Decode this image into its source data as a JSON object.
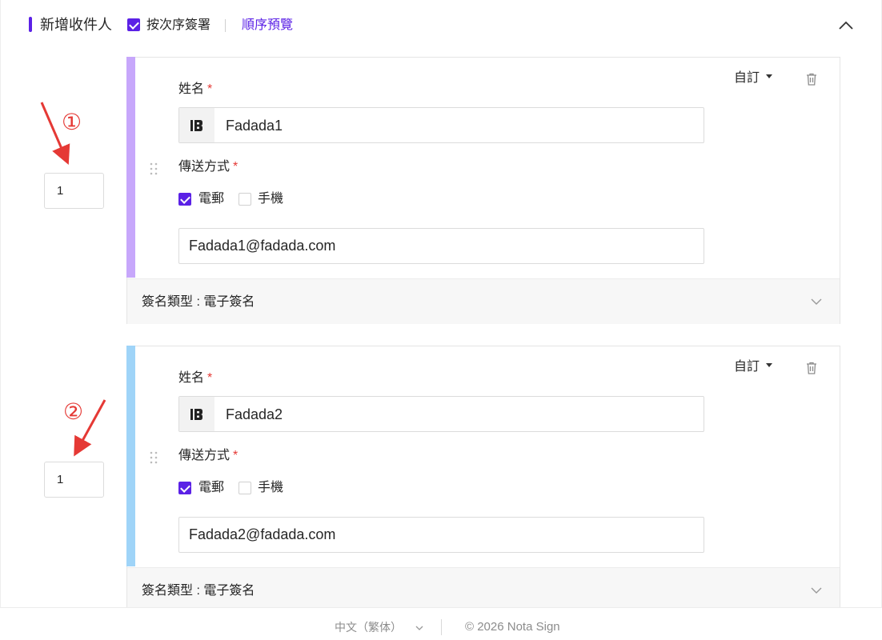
{
  "header": {
    "title": "新增收件人",
    "sequential_label": "按次序簽署",
    "sequential_checked": true,
    "preview_link": "順序預覽"
  },
  "annotations": [
    "①",
    "②"
  ],
  "recipients": [
    {
      "order": "1",
      "name_label": "姓名",
      "name_value": "Fadada1",
      "role_dropdown": "自訂",
      "method_label": "傳送方式",
      "method_email": "電郵",
      "method_email_checked": true,
      "method_phone": "手機",
      "method_phone_checked": false,
      "email_value": "Fadada1@fadada.com",
      "sig_type": "簽名類型 : 電子簽名",
      "stripe_color": "#c7a7fb"
    },
    {
      "order": "1",
      "name_label": "姓名",
      "name_value": "Fadada2",
      "role_dropdown": "自訂",
      "method_label": "傳送方式",
      "method_email": "電郵",
      "method_email_checked": true,
      "method_phone": "手機",
      "method_phone_checked": false,
      "email_value": "Fadada2@fadada.com",
      "sig_type": "簽名類型 : 電子簽名",
      "stripe_color": "#9fd4f8"
    }
  ],
  "footer": {
    "language": "中文（繁体）",
    "copyright": "© 2026 Nota Sign"
  },
  "colors": {
    "accent": "#5b21e6",
    "required": "#e53935",
    "annotation": "#e53935"
  }
}
